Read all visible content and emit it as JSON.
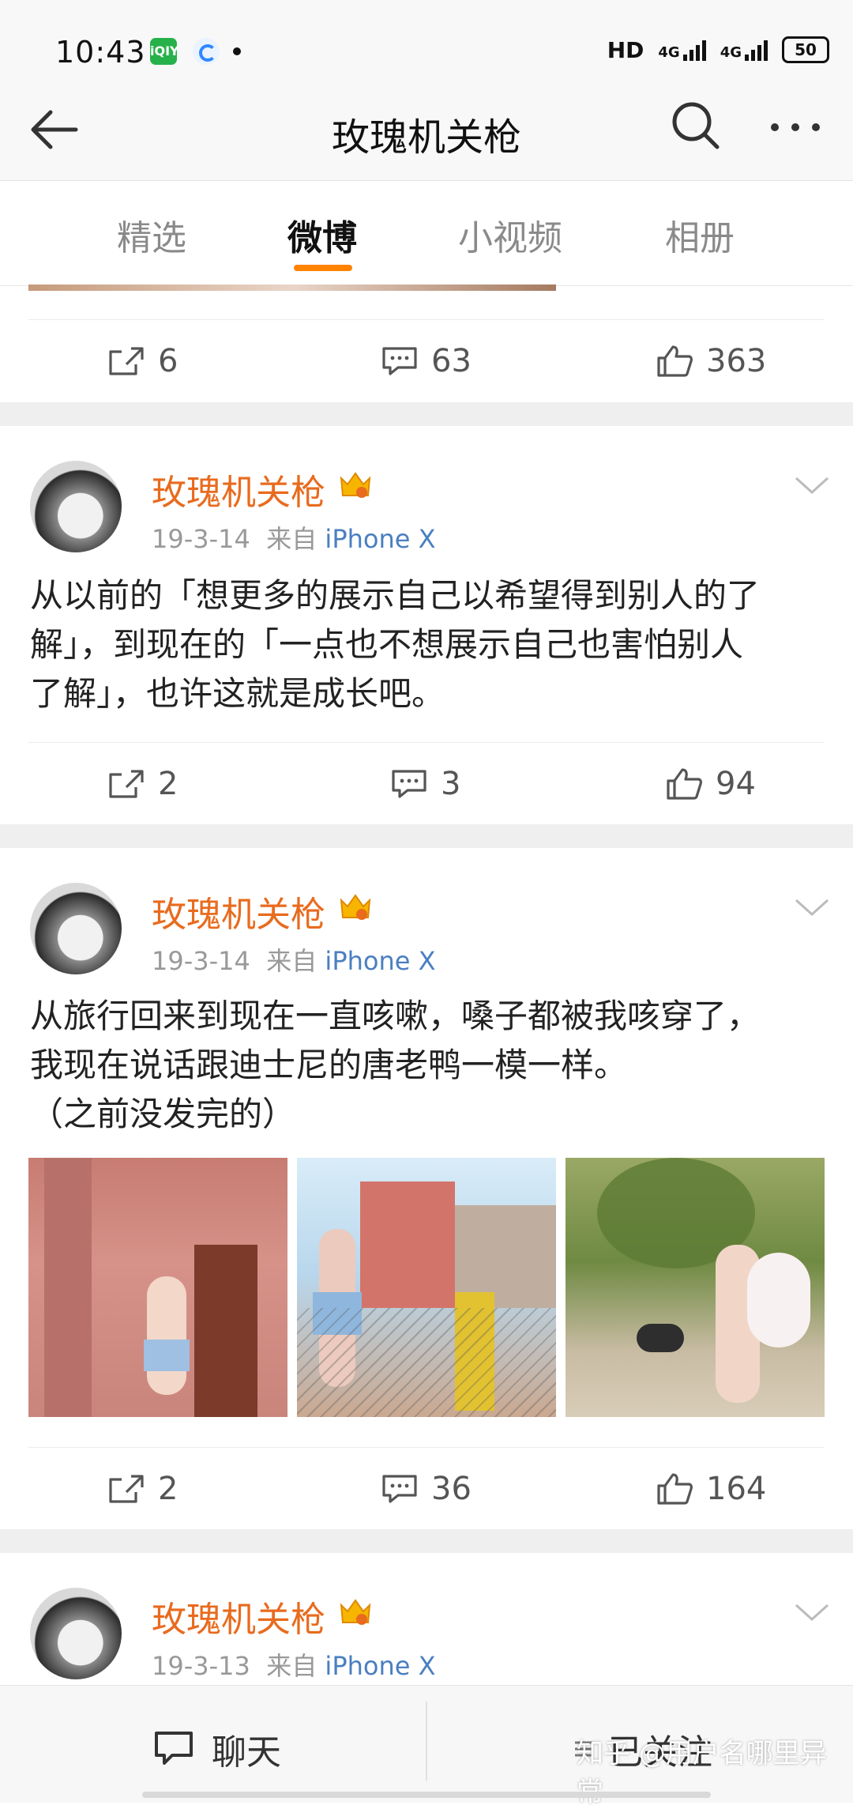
{
  "status_bar": {
    "time": "10:43",
    "app1_label": "iQIY",
    "network": "HD",
    "signal1": "4G",
    "signal2": "4G",
    "battery": "50"
  },
  "header": {
    "title": "玫瑰机关枪",
    "icons": [
      "back-arrow-icon",
      "search-icon",
      "more-icon"
    ]
  },
  "tabs": [
    {
      "label": "精选",
      "active": false
    },
    {
      "label": "微博",
      "active": true
    },
    {
      "label": "小视频",
      "active": false
    },
    {
      "label": "相册",
      "active": false
    }
  ],
  "accent_color": "#ff8200",
  "name_color": "#e86b1e",
  "device_color": "#4a7fc1",
  "first_actions": {
    "repost": "6",
    "comment": "63",
    "like": "363"
  },
  "posts": [
    {
      "author": "玫瑰机关枪",
      "date": "19-3-14",
      "from_label": "来自",
      "device": "iPhone X",
      "text_lines": [
        "从以前的「想更多的展示自己以希望得到别人的了",
        "解」，到现在的「一点也不想展示自己也害怕别人",
        "了解」，也许这就是成长吧。"
      ],
      "repost": "2",
      "comment": "3",
      "like": "94"
    },
    {
      "author": "玫瑰机关枪",
      "date": "19-3-14",
      "from_label": "来自",
      "device": "iPhone X",
      "text_lines": [
        "从旅行回来到现在一直咳嗽，嗓子都被我咳穿了，",
        "我现在说话跟迪士尼的唐老鸭一模一样。",
        "（之前没发完的）"
      ],
      "repost": "2",
      "comment": "36",
      "like": "164"
    },
    {
      "author": "玫瑰机关枪",
      "date": "19-3-13",
      "from_label": "来自",
      "device": "iPhone X"
    }
  ],
  "bottom_bar": {
    "chat_label": "聊天",
    "follow_label": "已关注",
    "watermark": "知乎 @用户名哪里异常"
  }
}
